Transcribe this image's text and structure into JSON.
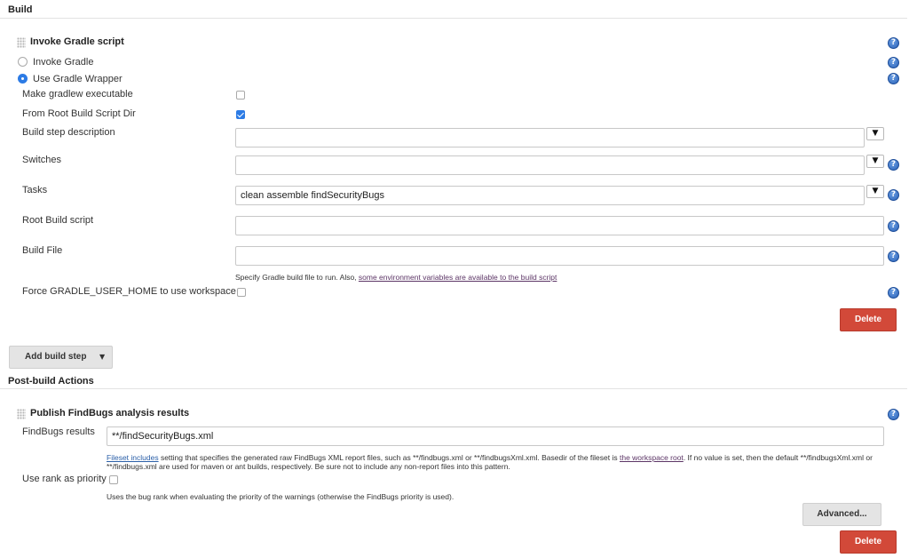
{
  "build": {
    "section_title": "Build",
    "gradle_step": {
      "title": "Invoke Gradle script",
      "radio_invoke_gradle": "Invoke Gradle",
      "radio_use_wrapper": "Use Gradle Wrapper",
      "make_executable_label": "Make gradlew executable",
      "make_executable_checked": false,
      "from_root_label": "From Root Build Script Dir",
      "from_root_checked": true,
      "step_description_label": "Build step description",
      "step_description_value": "",
      "switches_label": "Switches",
      "switches_value": "",
      "tasks_label": "Tasks",
      "tasks_value": "clean assemble findSecurityBugs",
      "root_build_script_label": "Root Build script",
      "root_build_script_value": "",
      "build_file_label": "Build File",
      "build_file_value": "",
      "build_file_help_prefix": "Specify Gradle build file to run. Also, ",
      "build_file_help_link": "some environment variables are available to the build script",
      "force_home_label": "Force GRADLE_USER_HOME to use workspace",
      "force_home_checked": false,
      "delete_label": "Delete"
    },
    "add_build_step_label": "Add build step",
    "dropdown_arrow": "▼"
  },
  "post_build": {
    "section_title": "Post-build Actions",
    "findbugs_step": {
      "title": "Publish FindBugs analysis results",
      "results_label": "FindBugs results",
      "results_value": "**/findSecurityBugs.xml",
      "fileset_link": "Fileset includes",
      "fileset_desc_1": " setting that specifies the generated raw FindBugs XML report files, such as **/findbugs.xml or **/findbugsXml.xml. Basedir of the fileset is ",
      "workspace_root_link": "the workspace root",
      "fileset_desc_2": ". If no value is set, then the default **/findbugsXml.xml or **/findbugs.xml are used for maven or ant builds, respectively. Be sure not to include any non-report files into this pattern.",
      "use_rank_label": "Use rank as priority",
      "use_rank_checked": false,
      "use_rank_desc": "Uses the bug rank when evaluating the priority of the warnings (otherwise the FindBugs priority is used).",
      "advanced_label": "Advanced...",
      "delete_label": "Delete"
    }
  },
  "icons": {
    "help": "?",
    "dropdown": "▼"
  },
  "colors": {
    "accent": "#2c7be5",
    "delete": "#d24939",
    "link": "#5c3566"
  }
}
